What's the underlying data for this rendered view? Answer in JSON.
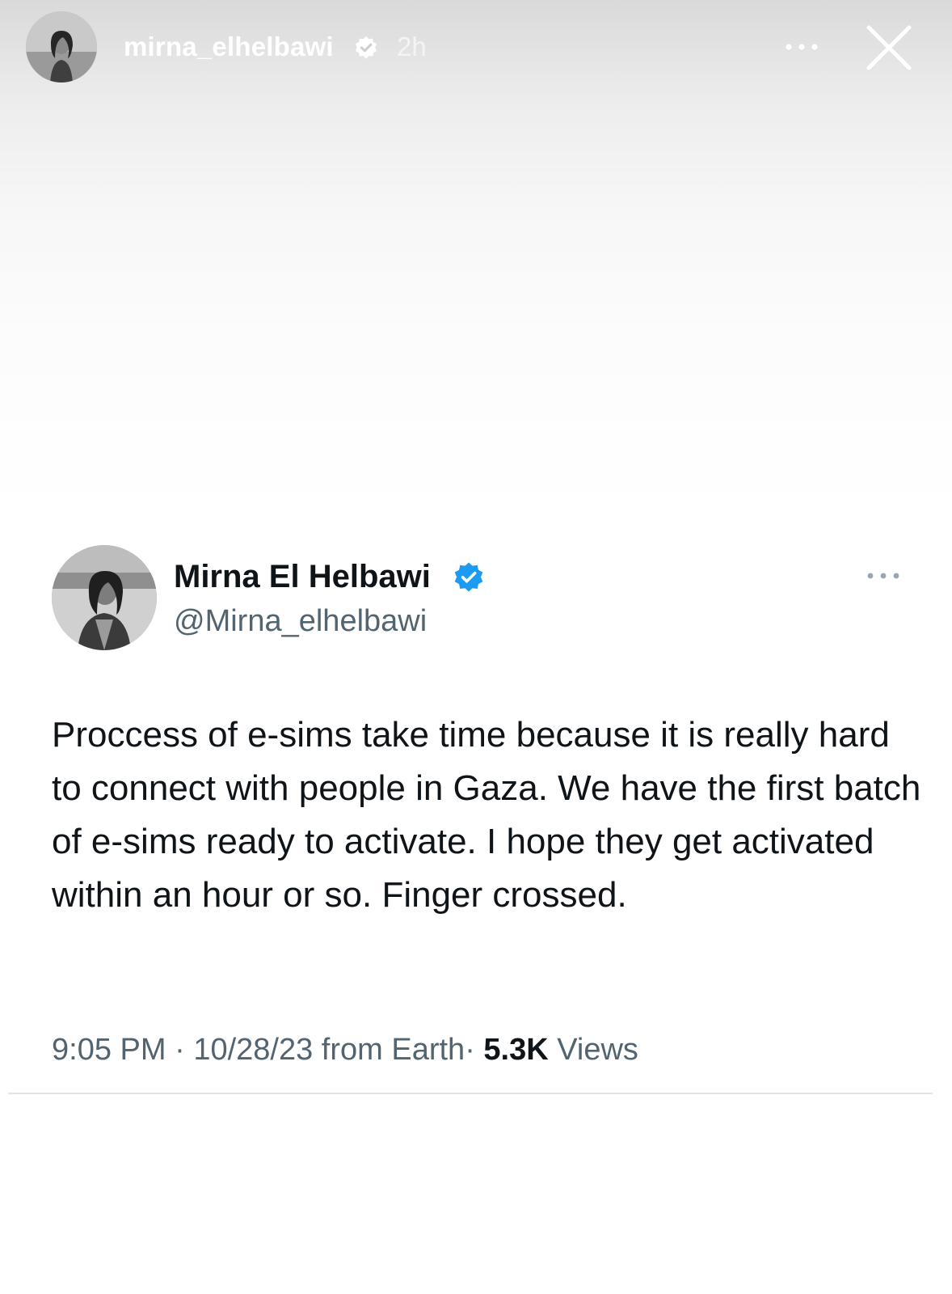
{
  "story": {
    "username": "mirna_elhelbawi",
    "time": "2h",
    "avatar_icon": "profile-photo",
    "verified_icon": "verified-badge-icon",
    "more_icon": "more-options-icon",
    "close_icon": "close-icon"
  },
  "tweet": {
    "display_name": "Mirna El Helbawi",
    "handle": "@Mirna_elhelbawi",
    "text": "Proccess of e-sims take time because it is really hard to connect with people in Gaza. We have the first batch of e-sims ready to activate. I hope they get activated within an hour or so. Finger crossed.",
    "meta": {
      "time": "9:05 PM",
      "separator": "·",
      "date": "10/28/23",
      "source": "from Earth",
      "views_count": "5.3K",
      "views_label": "Views"
    },
    "verified_color": "#1d9bf0"
  }
}
